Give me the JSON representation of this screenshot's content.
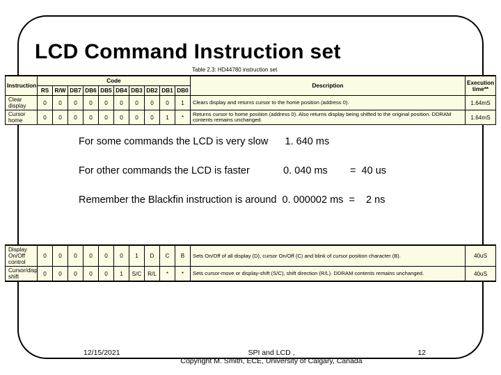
{
  "title": "LCD Command Instruction set",
  "caption": "Table 2.3: HD44780 instruction set",
  "columns": {
    "instruction": "Instruction",
    "code": "Code",
    "rs": "RS",
    "rw": "R/W",
    "db7": "DB7",
    "db6": "DB6",
    "db5": "DB5",
    "db4": "DB4",
    "db3": "DB3",
    "db2": "DB2",
    "db1": "DB1",
    "db0": "DB0",
    "description": "Description",
    "exec": "Execution time**"
  },
  "rows_top": [
    {
      "instr": "Clear display",
      "bits": [
        "0",
        "0",
        "0",
        "0",
        "0",
        "0",
        "0",
        "0",
        "0",
        "1"
      ],
      "desc": "Clears display and returns cursor to the home position (address 0).",
      "exec": "1.64mS"
    },
    {
      "instr": "Cursor home",
      "bits": [
        "0",
        "0",
        "0",
        "0",
        "0",
        "0",
        "0",
        "0",
        "1",
        "*"
      ],
      "desc": "Returns cursor to home position (address 0). Also returns display being shifted to the original position. DDRAM contents remains unchanged.",
      "exec": "1.64mS"
    }
  ],
  "rows_bottom": [
    {
      "instr": "Display On/Off control",
      "bits": [
        "0",
        "0",
        "0",
        "0",
        "0",
        "0",
        "1",
        "D",
        "C",
        "B"
      ],
      "desc": "Sets On/Off of all display (D), cursor On/Off (C) and blink of cursor position character (B).",
      "exec": "40uS"
    },
    {
      "instr": "Cursor/display shift",
      "bits": [
        "0",
        "0",
        "0",
        "0",
        "0",
        "1",
        "S/C",
        "R/L",
        "*",
        "*"
      ],
      "desc": "Sets cursor-move or display-shift (S/C), shift direction (R/L). DDRAM contents remains unchanged.",
      "exec": "40uS"
    }
  ],
  "body": {
    "line1": "For some commands the LCD is very slow      1. 640 ms",
    "line2": "For other commands the LCD is faster            0. 040 ms        =  40 us",
    "line3": "Remember the Blackfin instruction is around  0. 000002 ms  =    2 ns"
  },
  "footer": {
    "date": "12/15/2021",
    "mid_line1": "SPI and LCD                              ,",
    "mid_line2": "Copyright M. Smith, ECE, University of Calgary, Canada",
    "page": "12"
  }
}
